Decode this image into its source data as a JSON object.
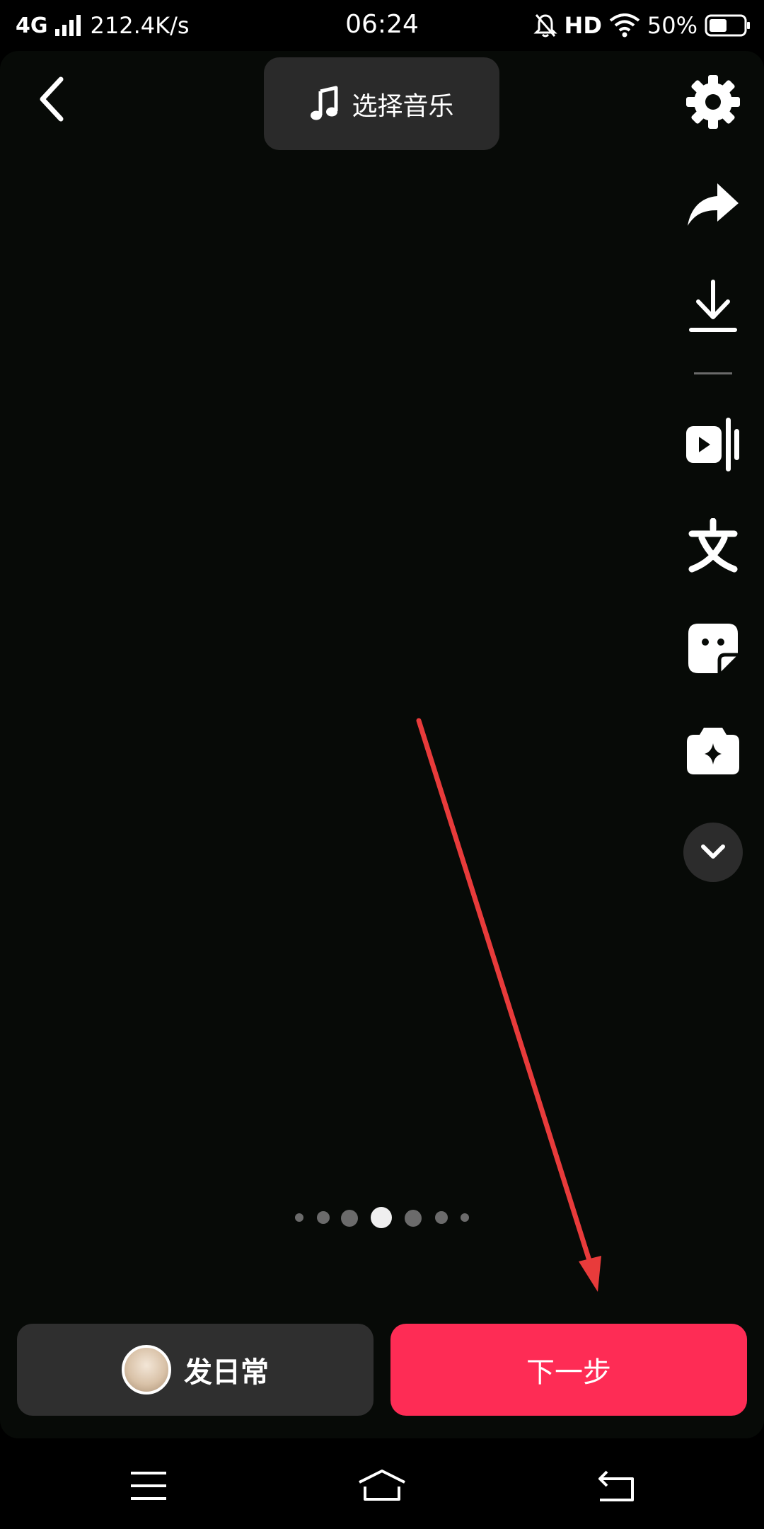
{
  "status_bar": {
    "network": "4G",
    "speed": "212.4K/s",
    "time": "06:24",
    "hd": "HD",
    "battery": "50%"
  },
  "top": {
    "music_label": "选择音乐"
  },
  "right_rail": {
    "items": [
      "gear-icon",
      "share-icon",
      "download-icon",
      "clip-icon",
      "text-icon",
      "sticker-icon",
      "effects-icon"
    ],
    "more": "chevron-down-icon"
  },
  "pager": {
    "count": 7,
    "active_index": 3
  },
  "bottom": {
    "daily_label": "发日常",
    "next_label": "下一步"
  },
  "colors": {
    "accent": "#fe2c55",
    "annotation": "#e83b3b"
  }
}
